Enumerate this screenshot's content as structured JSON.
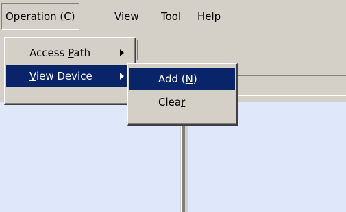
{
  "menubar": {
    "items": [
      {
        "label_pre": "Operation (",
        "label_u": "C",
        "label_post": ")"
      },
      {
        "label_pre": "",
        "label_u": "V",
        "label_post": "iew"
      },
      {
        "label_pre": "",
        "label_u": "T",
        "label_post": "ool"
      },
      {
        "label_pre": "",
        "label_u": "H",
        "label_post": "elp"
      }
    ]
  },
  "operation_menu": {
    "items": [
      {
        "label_pre": "Access ",
        "label_u": "P",
        "label_post": "ath",
        "has_submenu": true,
        "selected": false
      },
      {
        "label_pre": "",
        "label_u": "V",
        "label_post": "iew Device",
        "has_submenu": true,
        "selected": true
      }
    ]
  },
  "view_device_submenu": {
    "items": [
      {
        "label_pre": "Add (",
        "label_u": "N",
        "label_post": ")",
        "selected": true
      },
      {
        "label_pre": "Clea",
        "label_u": "r",
        "label_post": "",
        "selected": false
      }
    ]
  },
  "colors": {
    "menu_bg": "#d4d0c8",
    "highlight": "#0a246a",
    "pane_bg": "#dfe7fb"
  }
}
